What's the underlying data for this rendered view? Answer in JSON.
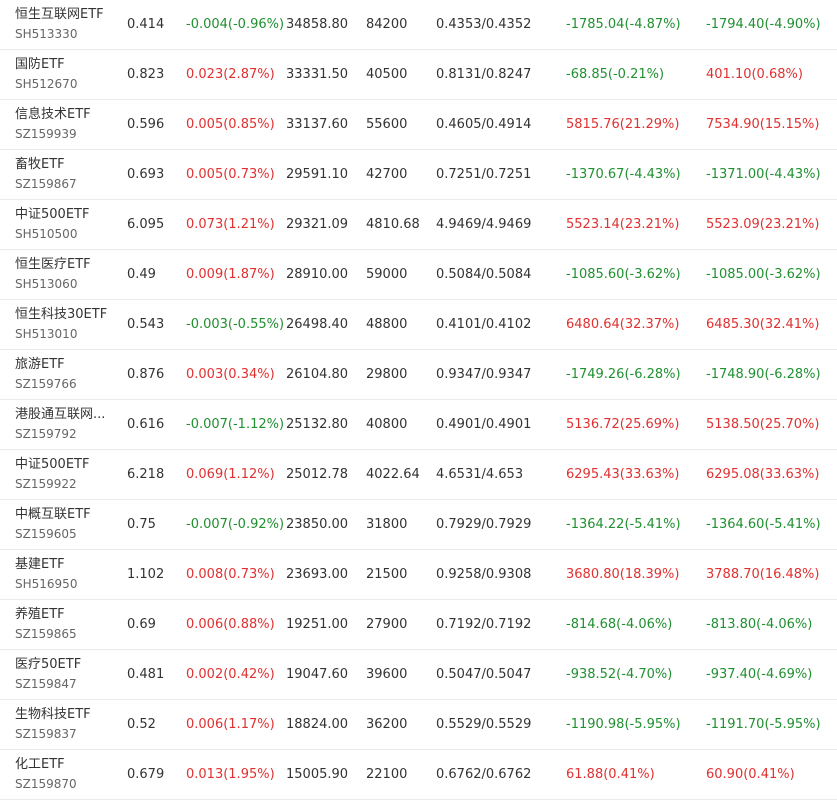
{
  "colors": {
    "up": "#e03131",
    "down": "#209030",
    "text": "#333333",
    "code": "#666666"
  },
  "rows": [
    {
      "name": "恒生互联网ETF",
      "code": "SH513330",
      "price": "0.414",
      "change": "-0.004(-0.96%)",
      "dir": "down",
      "amount": "34858.80",
      "volume": "84200",
      "iopv": "0.4353/0.4352",
      "premium1": "-1785.04(-4.87%)",
      "p1dir": "down",
      "premium2": "-1794.40(-4.90%)",
      "p2dir": "down"
    },
    {
      "name": "国防ETF",
      "code": "SH512670",
      "price": "0.823",
      "change": "0.023(2.87%)",
      "dir": "up",
      "amount": "33331.50",
      "volume": "40500",
      "iopv": "0.8131/0.8247",
      "premium1": "-68.85(-0.21%)",
      "p1dir": "down",
      "premium2": "401.10(0.68%)",
      "p2dir": "up"
    },
    {
      "name": "信息技术ETF",
      "code": "SZ159939",
      "price": "0.596",
      "change": "0.005(0.85%)",
      "dir": "up",
      "amount": "33137.60",
      "volume": "55600",
      "iopv": "0.4605/0.4914",
      "premium1": "5815.76(21.29%)",
      "p1dir": "up",
      "premium2": "7534.90(15.15%)",
      "p2dir": "up"
    },
    {
      "name": "畜牧ETF",
      "code": "SZ159867",
      "price": "0.693",
      "change": "0.005(0.73%)",
      "dir": "up",
      "amount": "29591.10",
      "volume": "42700",
      "iopv": "0.7251/0.7251",
      "premium1": "-1370.67(-4.43%)",
      "p1dir": "down",
      "premium2": "-1371.00(-4.43%)",
      "p2dir": "down"
    },
    {
      "name": "中证500ETF",
      "code": "SH510500",
      "price": "6.095",
      "change": "0.073(1.21%)",
      "dir": "up",
      "amount": "29321.09",
      "volume": "4810.68",
      "iopv": "4.9469/4.9469",
      "premium1": "5523.14(23.21%)",
      "p1dir": "up",
      "premium2": "5523.09(23.21%)",
      "p2dir": "up"
    },
    {
      "name": "恒生医疗ETF",
      "code": "SH513060",
      "price": "0.49",
      "change": "0.009(1.87%)",
      "dir": "up",
      "amount": "28910.00",
      "volume": "59000",
      "iopv": "0.5084/0.5084",
      "premium1": "-1085.60(-3.62%)",
      "p1dir": "down",
      "premium2": "-1085.00(-3.62%)",
      "p2dir": "down"
    },
    {
      "name": "恒生科技30ETF",
      "code": "SH513010",
      "price": "0.543",
      "change": "-0.003(-0.55%)",
      "dir": "down",
      "amount": "26498.40",
      "volume": "48800",
      "iopv": "0.4101/0.4102",
      "premium1": "6480.64(32.37%)",
      "p1dir": "up",
      "premium2": "6485.30(32.41%)",
      "p2dir": "up"
    },
    {
      "name": "旅游ETF",
      "code": "SZ159766",
      "price": "0.876",
      "change": "0.003(0.34%)",
      "dir": "up",
      "amount": "26104.80",
      "volume": "29800",
      "iopv": "0.9347/0.9347",
      "premium1": "-1749.26(-6.28%)",
      "p1dir": "down",
      "premium2": "-1748.90(-6.28%)",
      "p2dir": "down"
    },
    {
      "name": "港股通互联网...",
      "code": "SZ159792",
      "price": "0.616",
      "change": "-0.007(-1.12%)",
      "dir": "down",
      "amount": "25132.80",
      "volume": "40800",
      "iopv": "0.4901/0.4901",
      "premium1": "5136.72(25.69%)",
      "p1dir": "up",
      "premium2": "5138.50(25.70%)",
      "p2dir": "up"
    },
    {
      "name": "中证500ETF",
      "code": "SZ159922",
      "price": "6.218",
      "change": "0.069(1.12%)",
      "dir": "up",
      "amount": "25012.78",
      "volume": "4022.64",
      "iopv": "4.6531/4.653",
      "premium1": "6295.43(33.63%)",
      "p1dir": "up",
      "premium2": "6295.08(33.63%)",
      "p2dir": "up"
    },
    {
      "name": "中概互联ETF",
      "code": "SZ159605",
      "price": "0.75",
      "change": "-0.007(-0.92%)",
      "dir": "down",
      "amount": "23850.00",
      "volume": "31800",
      "iopv": "0.7929/0.7929",
      "premium1": "-1364.22(-5.41%)",
      "p1dir": "down",
      "premium2": "-1364.60(-5.41%)",
      "p2dir": "down"
    },
    {
      "name": "基建ETF",
      "code": "SH516950",
      "price": "1.102",
      "change": "0.008(0.73%)",
      "dir": "up",
      "amount": "23693.00",
      "volume": "21500",
      "iopv": "0.9258/0.9308",
      "premium1": "3680.80(18.39%)",
      "p1dir": "up",
      "premium2": "3788.70(16.48%)",
      "p2dir": "up"
    },
    {
      "name": "养殖ETF",
      "code": "SZ159865",
      "price": "0.69",
      "change": "0.006(0.88%)",
      "dir": "up",
      "amount": "19251.00",
      "volume": "27900",
      "iopv": "0.7192/0.7192",
      "premium1": "-814.68(-4.06%)",
      "p1dir": "down",
      "premium2": "-813.80(-4.06%)",
      "p2dir": "down"
    },
    {
      "name": "医疗50ETF",
      "code": "SZ159847",
      "price": "0.481",
      "change": "0.002(0.42%)",
      "dir": "up",
      "amount": "19047.60",
      "volume": "39600",
      "iopv": "0.5047/0.5047",
      "premium1": "-938.52(-4.70%)",
      "p1dir": "down",
      "premium2": "-937.40(-4.69%)",
      "p2dir": "down"
    },
    {
      "name": "生物科技ETF",
      "code": "SZ159837",
      "price": "0.52",
      "change": "0.006(1.17%)",
      "dir": "up",
      "amount": "18824.00",
      "volume": "36200",
      "iopv": "0.5529/0.5529",
      "premium1": "-1190.98(-5.95%)",
      "p1dir": "down",
      "premium2": "-1191.70(-5.95%)",
      "p2dir": "down"
    },
    {
      "name": "化工ETF",
      "code": "SZ159870",
      "price": "0.679",
      "change": "0.013(1.95%)",
      "dir": "up",
      "amount": "15005.90",
      "volume": "22100",
      "iopv": "0.6762/0.6762",
      "premium1": "61.88(0.41%)",
      "p1dir": "up",
      "premium2": "60.90(0.41%)",
      "p2dir": "up"
    }
  ]
}
